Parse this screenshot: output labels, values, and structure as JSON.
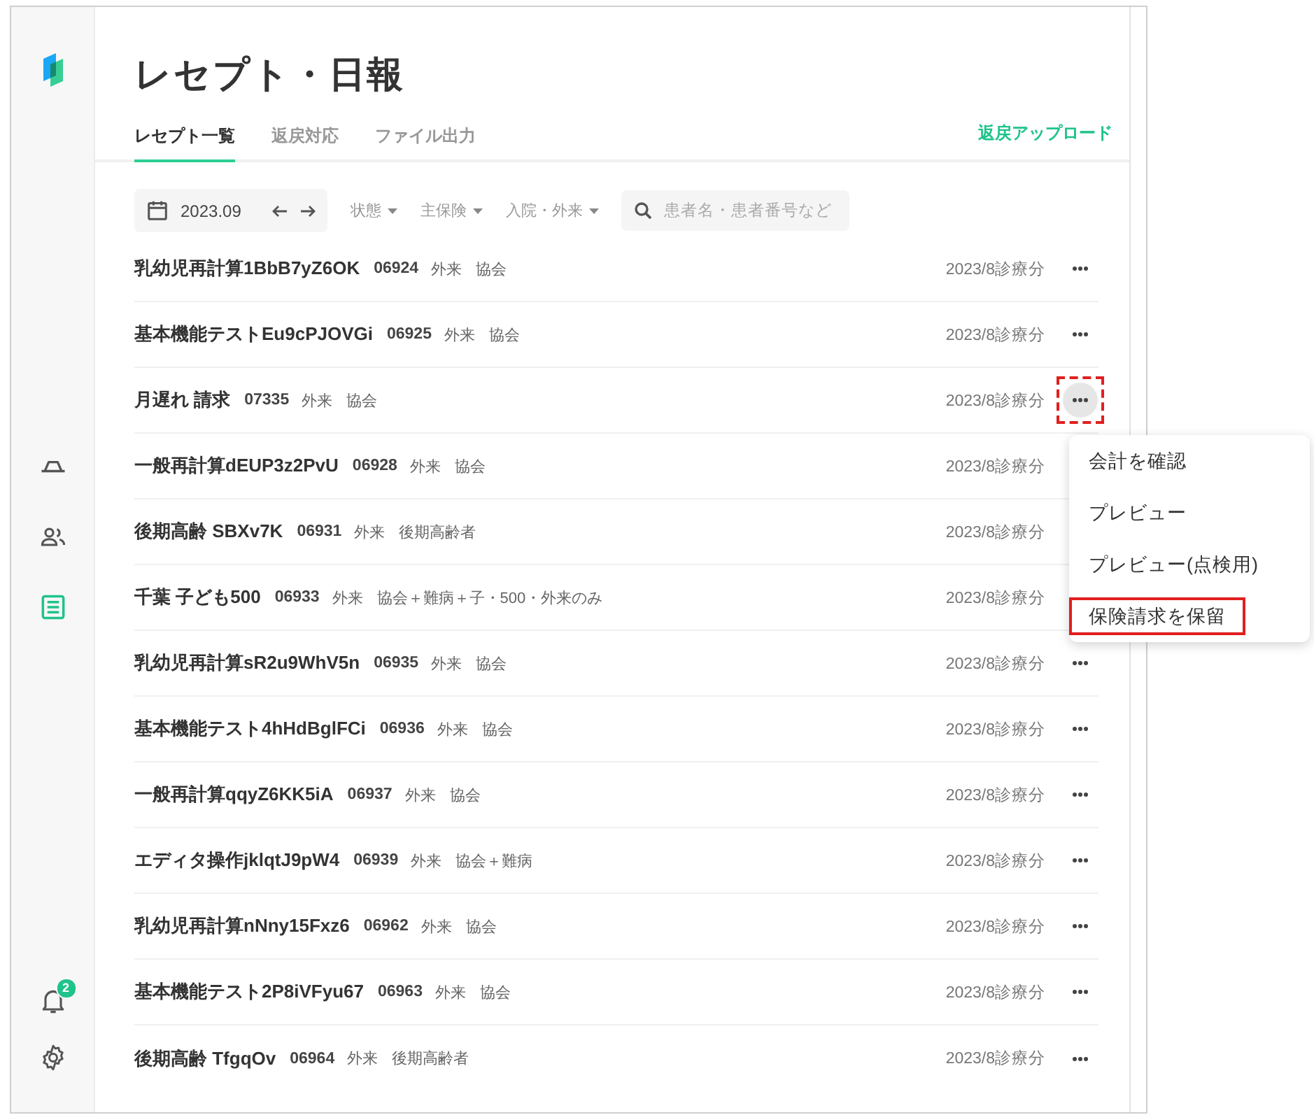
{
  "page": {
    "title": "レセプト・日報"
  },
  "sidebar": {
    "items": [
      {
        "kind": "tray",
        "selected": false
      },
      {
        "kind": "people",
        "selected": false
      },
      {
        "kind": "list",
        "selected": true
      }
    ],
    "notifications": {
      "badge": "2"
    }
  },
  "tabs": [
    {
      "label": "レセプト一覧",
      "selected": true
    },
    {
      "label": "返戻対応",
      "selected": false
    },
    {
      "label": "ファイル出力",
      "selected": false
    }
  ],
  "header_action": "返戻アップロード",
  "toolbar": {
    "month": "2023.09",
    "filters": [
      "状態",
      "主保険",
      "入院・外来"
    ],
    "search": {
      "placeholder": "患者名・患者番号など"
    }
  },
  "rows": [
    {
      "name": "乳幼児再計算1BbB7yZ6OK",
      "number": "06924",
      "visit": "外来",
      "insurance": "協会",
      "period": "2023/8診療分",
      "menu_open": false
    },
    {
      "name": "基本機能テストEu9cPJOVGi",
      "number": "06925",
      "visit": "外来",
      "insurance": "協会",
      "period": "2023/8診療分",
      "menu_open": false
    },
    {
      "name": "月遅れ 請求",
      "number": "07335",
      "visit": "外来",
      "insurance": "協会",
      "period": "2023/8診療分",
      "menu_open": true
    },
    {
      "name": "一般再計算dEUP3z2PvU",
      "number": "06928",
      "visit": "外来",
      "insurance": "協会",
      "period": "2023/8診療分"
    },
    {
      "name": "後期高齢 SBXv7K",
      "number": "06931",
      "visit": "外来",
      "insurance": "後期高齢者",
      "period": "2023/8診療分"
    },
    {
      "name": "千葉 子ども500",
      "number": "06933",
      "visit": "外来",
      "insurance": "協会＋難病＋子・500・外来のみ",
      "period": "2023/8診療分"
    },
    {
      "name": "乳幼児再計算sR2u9WhV5n",
      "number": "06935",
      "visit": "外来",
      "insurance": "協会",
      "period": "2023/8診療分",
      "menu_open": false
    },
    {
      "name": "基本機能テスト4hHdBglFCi",
      "number": "06936",
      "visit": "外来",
      "insurance": "協会",
      "period": "2023/8診療分",
      "menu_open": false
    },
    {
      "name": "一般再計算qqyZ6KK5iA",
      "number": "06937",
      "visit": "外来",
      "insurance": "協会",
      "period": "2023/8診療分",
      "menu_open": false
    },
    {
      "name": "エディタ操作jklqtJ9pW4",
      "number": "06939",
      "visit": "外来",
      "insurance": "協会＋難病",
      "period": "2023/8診療分",
      "menu_open": false
    },
    {
      "name": "乳幼児再計算nNny15Fxz6",
      "number": "06962",
      "visit": "外来",
      "insurance": "協会",
      "period": "2023/8診療分",
      "menu_open": false
    },
    {
      "name": "基本機能テスト2P8iVFyu67",
      "number": "06963",
      "visit": "外来",
      "insurance": "協会",
      "period": "2023/8診療分",
      "menu_open": false
    },
    {
      "name": "後期高齢 TfgqOv",
      "number": "06964",
      "visit": "外来",
      "insurance": "後期高齢者",
      "period": "2023/8診療分",
      "menu_open": false
    }
  ],
  "row_menu": {
    "items": [
      {
        "label": "会計を確認",
        "highlighted": false
      },
      {
        "label": "プレビュー",
        "highlighted": false
      },
      {
        "label": "プレビュー(点検用)",
        "highlighted": false
      },
      {
        "label": "保険請求を保留",
        "highlighted": true
      }
    ]
  }
}
